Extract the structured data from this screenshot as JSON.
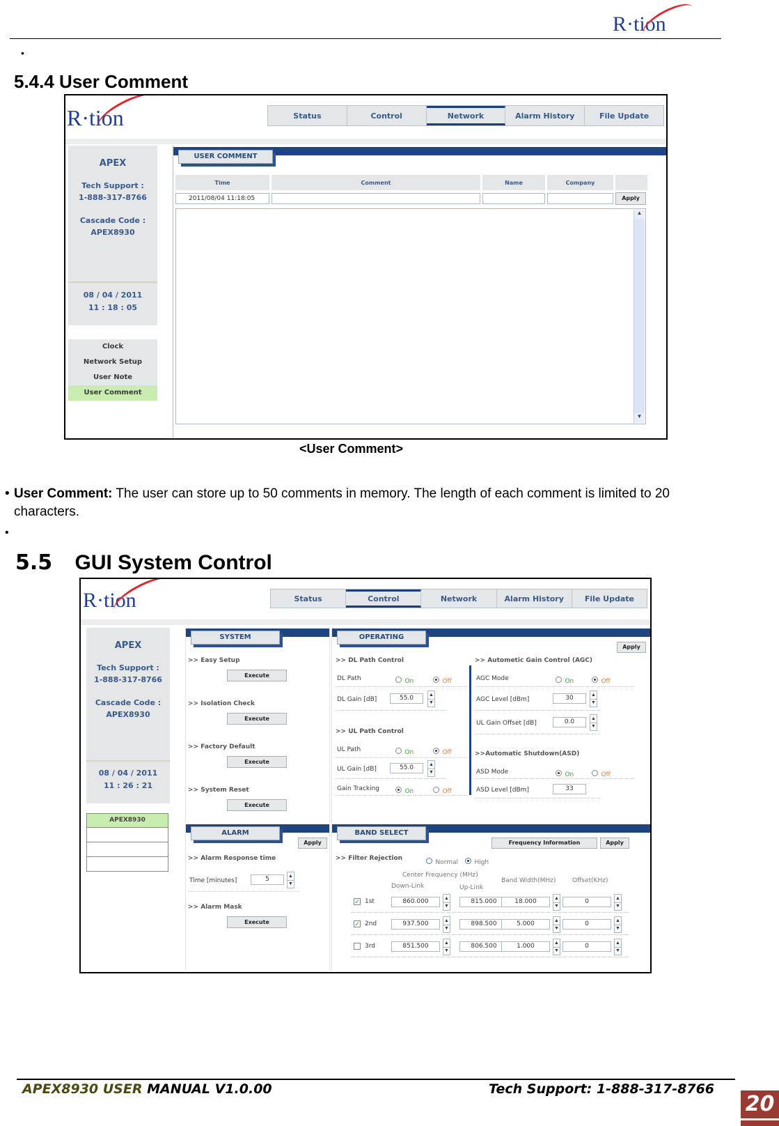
{
  "header": {
    "logo": "R·tion"
  },
  "section_544": {
    "heading": "5.4.4 User Comment",
    "screenshot": {
      "logo": "R·tion",
      "tabs": [
        {
          "label": "Status",
          "active": false
        },
        {
          "label": "Control",
          "active": false
        },
        {
          "label": "Network",
          "active": true
        },
        {
          "label": "Alarm History",
          "active": false
        },
        {
          "label": "File Update",
          "active": false
        }
      ],
      "sidebar": {
        "product": "APEX",
        "support_label": "Tech Support :",
        "support_phone": "1-888-317-8766",
        "cascade_label": "Cascade Code :",
        "cascade_code": "APEX8930",
        "date": "08 / 04 / 2011",
        "time": "11 : 18 : 05",
        "menu": [
          {
            "label": "Clock",
            "active": false
          },
          {
            "label": "Network Setup",
            "active": false
          },
          {
            "label": "User Note",
            "active": false
          },
          {
            "label": "User Comment",
            "active": true
          }
        ]
      },
      "panel_title": "USER COMMENT",
      "columns": [
        "Time",
        "Comment",
        "Name",
        "Company"
      ],
      "row": {
        "time": "2011/08/04 11:18:05",
        "comment": "",
        "name": "",
        "company": ""
      },
      "apply_label": "Apply"
    },
    "caption": "<User Comment>",
    "bullet_bold": "User Comment:",
    "bullet_text": " The user can store up to 50 comments in memory. The length of each comment is limited to 20 characters."
  },
  "section_55": {
    "heading_num": "5.5",
    "heading": "GUI System Control",
    "screenshot": {
      "logo": "R·tion",
      "tabs": [
        {
          "label": "Status",
          "active": false
        },
        {
          "label": "Control",
          "active": true
        },
        {
          "label": "Network",
          "active": false
        },
        {
          "label": "Alarm History",
          "active": false
        },
        {
          "label": "File Update",
          "active": false
        }
      ],
      "sidebar": {
        "product": "APEX",
        "support_label": "Tech Support :",
        "support_phone": "1-888-317-8766",
        "cascade_label": "Cascade Code :",
        "cascade_code": "APEX8930",
        "date": "08 / 04 / 2011",
        "time": "11 : 26 : 21",
        "cascade_list": [
          "APEX8930",
          "",
          "",
          ""
        ]
      },
      "system": {
        "title": "SYSTEM",
        "items": [
          {
            "label": ">> Easy Setup",
            "button": "Execute"
          },
          {
            "label": ">> Isolation Check",
            "button": "Execute"
          },
          {
            "label": ">> Factory Default",
            "button": "Execute"
          },
          {
            "label": ">> System Reset",
            "button": "Execute"
          }
        ]
      },
      "operating": {
        "title": "OPERATING",
        "apply": "Apply",
        "dl_section": ">> DL Path Control",
        "dl_path": {
          "label": "DL Path",
          "on": "On",
          "off": "Off",
          "selected": "off"
        },
        "dl_gain": {
          "label": "DL Gain [dB]",
          "value": "55.0"
        },
        "ul_section": ">> UL Path Control",
        "ul_path": {
          "label": "UL Path",
          "on": "On",
          "off": "Off",
          "selected": "off"
        },
        "ul_gain": {
          "label": "UL Gain [dB]",
          "value": "55.0"
        },
        "gain_tracking": {
          "label": "Gain Tracking",
          "on": "On",
          "off": "Off",
          "selected": "on"
        },
        "agc_section": ">> Autometic Gain Control (AGC)",
        "agc_mode": {
          "label": "AGC Mode",
          "on": "On",
          "off": "Off",
          "selected": "off"
        },
        "agc_level": {
          "label": "AGC Level [dBm]",
          "value": "30"
        },
        "ul_gain_offset": {
          "label": "UL Gain Offset [dB]",
          "value": "0.0"
        },
        "asd_section": ">>Automatic Shutdown(ASD)",
        "asd_mode": {
          "label": "ASD Mode",
          "on": "On",
          "off": "Off",
          "selected": "on"
        },
        "asd_level": {
          "label": "ASD Level [dBm]",
          "value": "33"
        }
      },
      "alarm": {
        "title": "ALARM",
        "apply": "Apply",
        "response_section": ">> Alarm Response time",
        "time_label": "Time [minutes]",
        "time_value": "5",
        "mask_section": ">> Alarm Mask",
        "mask_button": "Execute"
      },
      "band_select": {
        "title": "BAND SELECT",
        "freq_info_button": "Frequency Information",
        "apply": "Apply",
        "filter_label": ">> Filter Rejection",
        "filter_normal": "Normal",
        "filter_high": "High",
        "filter_selected": "high",
        "center_freq_label": "Center Frequency (MHz)",
        "downlink_label": "Down-Link",
        "uplink_label": "Up-Link",
        "bandwidth_label": "Band Width(MHz)",
        "offset_label": "Offset(KHz)",
        "bands": [
          {
            "name": "1st",
            "checked": true,
            "downlink": "860.000",
            "uplink": "815.000",
            "bandwidth": "18.000",
            "offset": "0"
          },
          {
            "name": "2nd",
            "checked": true,
            "downlink": "937.500",
            "uplink": "898.500",
            "bandwidth": "5.000",
            "offset": "0"
          },
          {
            "name": "3rd",
            "checked": false,
            "downlink": "851.500",
            "uplink": "806.500",
            "bandwidth": "1.000",
            "offset": "0"
          }
        ]
      }
    }
  },
  "footer": {
    "left_a": "APEX8930 USER",
    "left_b": " MANUAL V1.0.00",
    "right": "Tech Support: 1-888-317-8766",
    "page": "20"
  }
}
